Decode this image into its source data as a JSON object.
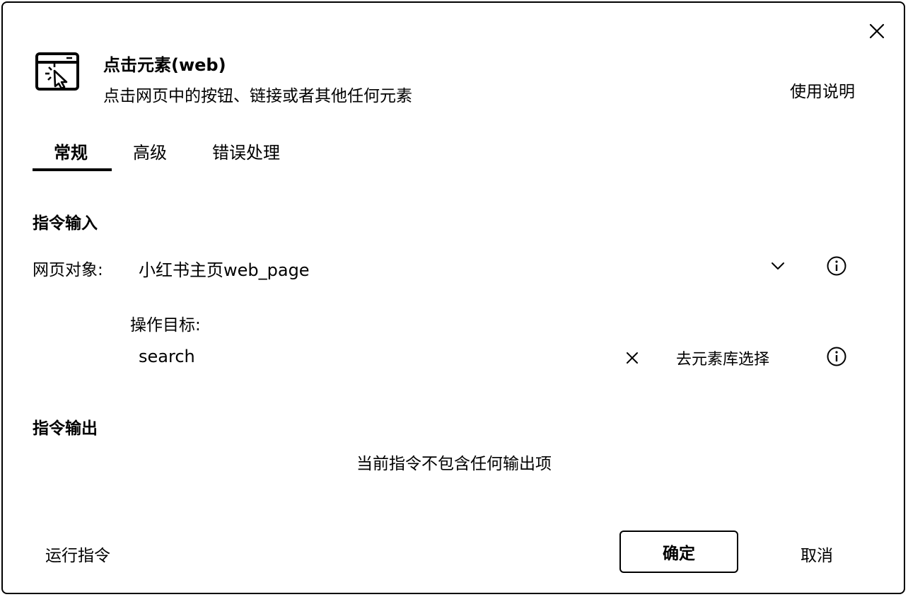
{
  "dialog": {
    "title": "点击元素(web)",
    "subtitle": "点击网页中的按钮、链接或者其他任何元素",
    "help_label": "使用说明",
    "icon": "cursor-click-window-icon",
    "close_icon": "close-icon"
  },
  "tabs": [
    {
      "label": "常规",
      "active": true
    },
    {
      "label": "高级",
      "active": false
    },
    {
      "label": "错误处理",
      "active": false
    }
  ],
  "input_section": {
    "heading": "指令输入",
    "web_object": {
      "label": "网页对象:",
      "value": "小红书主页web_page",
      "icon": "chevron-down-icon",
      "info_icon": "info-icon"
    },
    "target": {
      "label": "操作目标:",
      "value": "search",
      "clear_icon": "close-icon",
      "library_label": "去元素库选择",
      "info_icon": "info-icon"
    }
  },
  "output_section": {
    "heading": "指令输出",
    "empty_text": "当前指令不包含任何输出项"
  },
  "footer": {
    "run_label": "运行指令",
    "confirm_label": "确定",
    "cancel_label": "取消"
  }
}
